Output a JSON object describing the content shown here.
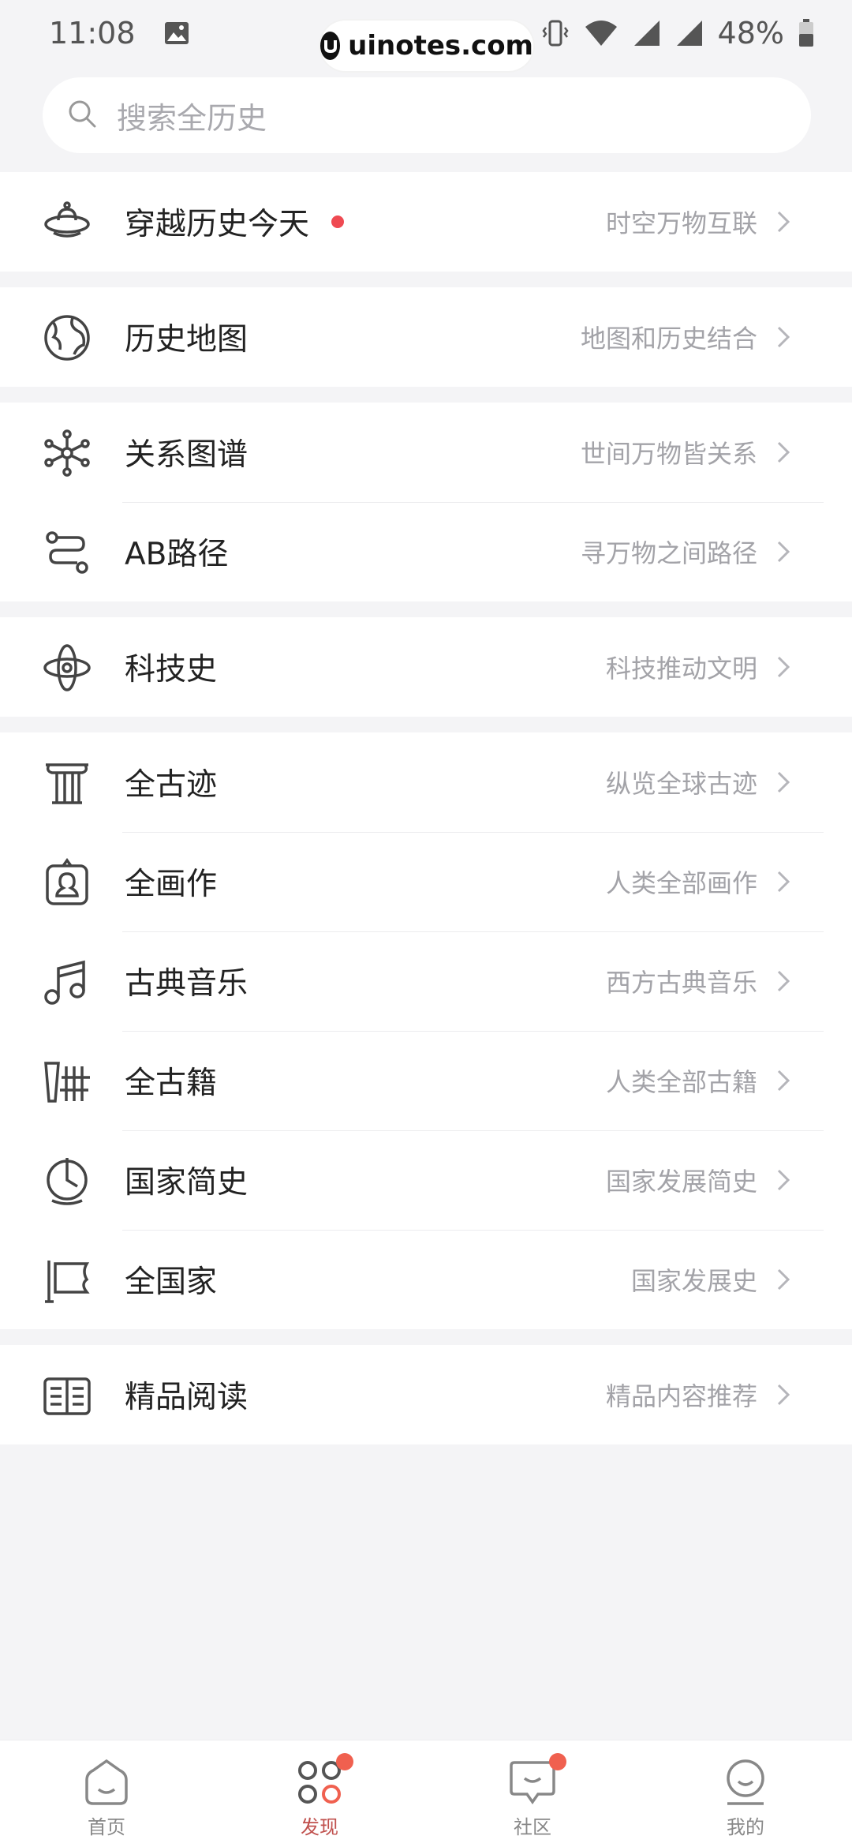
{
  "status_bar": {
    "time": "11:08",
    "battery": "48%",
    "icons": [
      "image-icon",
      "vibrate-icon",
      "wifi-icon",
      "signal-icon",
      "signal-icon",
      "battery-icon"
    ]
  },
  "watermark": {
    "text": "uinotes.com"
  },
  "search": {
    "placeholder": "搜索全历史"
  },
  "groups": [
    [
      {
        "icon": "ufo-icon",
        "title": "穿越历史今天",
        "subtitle": "时空万物互联",
        "badge": true
      }
    ],
    [
      {
        "icon": "globe-icon",
        "title": "历史地图",
        "subtitle": "地图和历史结合"
      }
    ],
    [
      {
        "icon": "network-icon",
        "title": "关系图谱",
        "subtitle": "世间万物皆关系"
      },
      {
        "icon": "route-icon",
        "title": "AB路径",
        "subtitle": "寻万物之间路径"
      }
    ],
    [
      {
        "icon": "atom-icon",
        "title": "科技史",
        "subtitle": "科技推动文明"
      }
    ],
    [
      {
        "icon": "column-icon",
        "title": "全古迹",
        "subtitle": "纵览全球古迹"
      },
      {
        "icon": "painting-icon",
        "title": "全画作",
        "subtitle": "人类全部画作"
      },
      {
        "icon": "music-note-icon",
        "title": "古典音乐",
        "subtitle": "西方古典音乐"
      },
      {
        "icon": "scroll-icon",
        "title": "全古籍",
        "subtitle": "人类全部古籍"
      },
      {
        "icon": "globe-stand-icon",
        "title": "国家简史",
        "subtitle": "国家发展简史"
      },
      {
        "icon": "flag-icon",
        "title": "全国家",
        "subtitle": "国家发展史"
      }
    ],
    [
      {
        "icon": "book-icon",
        "title": "精品阅读",
        "subtitle": "精品内容推荐"
      }
    ]
  ],
  "tabs": [
    {
      "label": "首页",
      "icon": "home-icon",
      "badge": false,
      "active": false
    },
    {
      "label": "发现",
      "icon": "discover-icon",
      "badge": true,
      "active": true
    },
    {
      "label": "社区",
      "icon": "community-icon",
      "badge": true,
      "active": false
    },
    {
      "label": "我的",
      "icon": "profile-icon",
      "badge": false,
      "active": false
    }
  ],
  "colors": {
    "accent": "#c0504d",
    "badge": "#ef4a52",
    "background": "#f4f4f6"
  }
}
